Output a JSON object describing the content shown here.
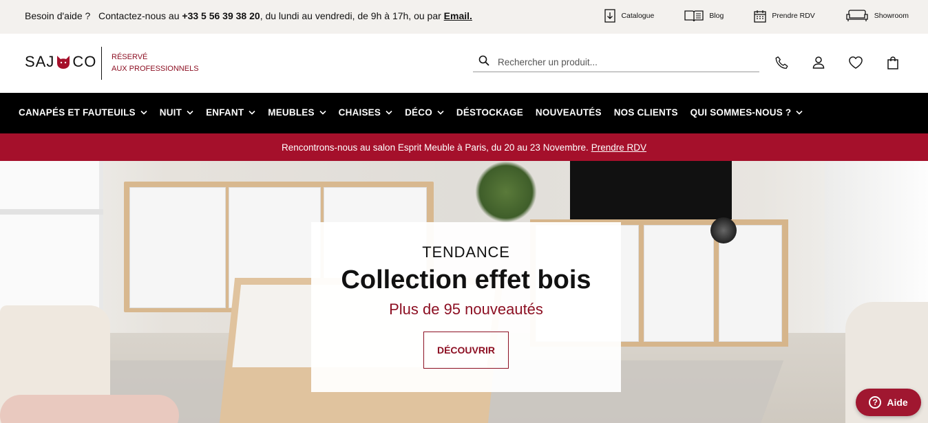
{
  "topbar": {
    "help_prefix": "Besoin d'aide ?",
    "help_contact": "Contactez-nous au",
    "phone": "+33 5 56 39 38 20",
    "help_hours": ", du lundi au vendredi, de 9h à 17h, ou par",
    "email_label": "Email.",
    "links": [
      {
        "label": "Catalogue",
        "icon": "catalogue-download-icon"
      },
      {
        "label": "Blog",
        "icon": "open-book-icon"
      },
      {
        "label": "Prendre RDV",
        "icon": "calendar-icon"
      },
      {
        "label": "Showroom",
        "icon": "sofa-icon"
      }
    ]
  },
  "header": {
    "logo_left": "SAJ",
    "logo_right": "CO",
    "reserved_line1": "Réservé",
    "reserved_line2": "aux professionnels",
    "search_placeholder": "Rechercher un produit...",
    "icons": [
      "phone-icon",
      "account-icon",
      "wishlist-heart-icon",
      "cart-bag-icon"
    ]
  },
  "nav": {
    "items": [
      {
        "label": "CANAPÉS ET FAUTEUILS",
        "dropdown": true
      },
      {
        "label": "NUIT",
        "dropdown": true
      },
      {
        "label": "ENFANT",
        "dropdown": true
      },
      {
        "label": "MEUBLES",
        "dropdown": true
      },
      {
        "label": "CHAISES",
        "dropdown": true
      },
      {
        "label": "DÉCO",
        "dropdown": true
      },
      {
        "label": "DÉSTOCKAGE",
        "dropdown": false
      },
      {
        "label": "NOUVEAUTÉS",
        "dropdown": false
      },
      {
        "label": "NOS CLIENTS",
        "dropdown": false
      },
      {
        "label": "QUI SOMMES-NOUS ?",
        "dropdown": true
      }
    ]
  },
  "promo": {
    "text": "Rencontrons-nous au salon Esprit Meuble à Paris, du 20 au 23 Novembre.",
    "link": "Prendre RDV"
  },
  "hero": {
    "kicker": "TENDANCE",
    "title": "Collection effet bois",
    "subtitle": "Plus de 95 nouveautés",
    "cta": "DÉCOUVRIR"
  },
  "aide": {
    "label": "Aide"
  },
  "colors": {
    "brand": "#a5102b",
    "brand_text": "#8c0f22",
    "nav_bg": "#000000",
    "topbar_bg": "#f3f1ee"
  }
}
